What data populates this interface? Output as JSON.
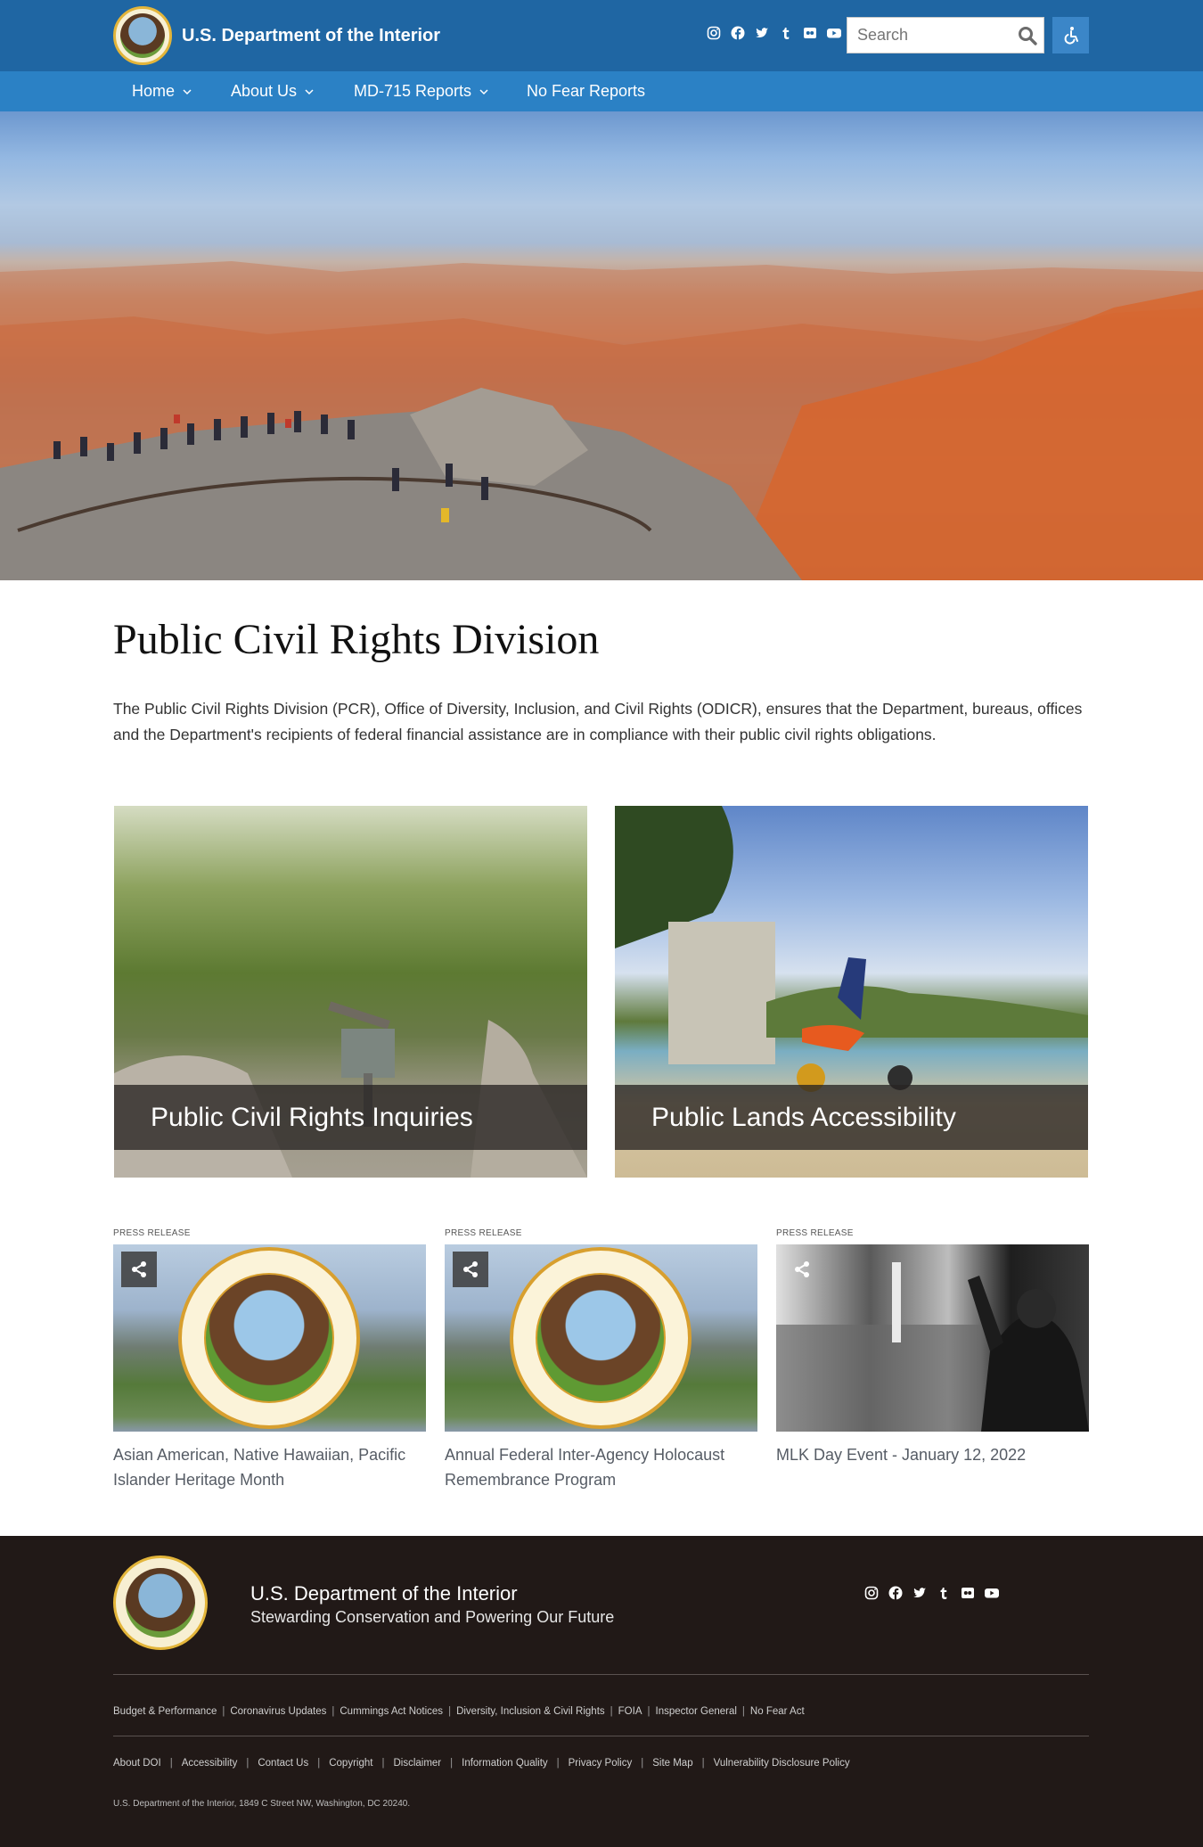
{
  "header": {
    "brand_name": "U.S. Department of the Interior",
    "social": [
      "instagram-icon",
      "facebook-icon",
      "twitter-icon",
      "tumblr-icon",
      "flickr-icon",
      "youtube-icon"
    ],
    "search_placeholder": "Search",
    "colors": {
      "topbar": "#1f66a3",
      "navbar": "#2b81c5"
    }
  },
  "nav": {
    "items": [
      {
        "label": "Home",
        "has_dropdown": true
      },
      {
        "label": "About Us",
        "has_dropdown": true
      },
      {
        "label": "MD-715 Reports",
        "has_dropdown": true
      },
      {
        "label": "No Fear Reports",
        "has_dropdown": false
      }
    ]
  },
  "main": {
    "title": "Public Civil Rights Division",
    "intro": "The Public Civil Rights Division (PCR), Office of Diversity, Inclusion, and Civil Rights (ODICR), ensures that the Department, bureaus, offices and the Department's recipients of federal financial assistance are in compliance with their public civil rights obligations."
  },
  "cards": [
    {
      "label": "Public Civil Rights Inquiries"
    },
    {
      "label": "Public Lands Accessibility"
    }
  ],
  "press": [
    {
      "tag": "PRESS RELEASE",
      "title": "Asian American, Native Hawaiian, Pacific Islander Heritage Month"
    },
    {
      "tag": "PRESS RELEASE",
      "title": "Annual Federal Inter-Agency Holocaust Remembrance Program"
    },
    {
      "tag": "PRESS RELEASE",
      "title": "MLK Day Event - January 12, 2022"
    }
  ],
  "footer": {
    "name": "U.S. Department of the Interior",
    "tagline": "Stewarding Conservation and Powering Our Future",
    "links_row1": [
      "Budget & Performance",
      "Coronavirus Updates",
      "Cummings Act Notices",
      "Diversity, Inclusion & Civil Rights",
      "FOIA",
      "Inspector General",
      "No Fear Act"
    ],
    "links_row2": [
      "About DOI",
      "Accessibility",
      "Contact Us",
      "Copyright",
      "Disclaimer",
      "Information Quality",
      "Privacy Policy",
      "Site Map",
      "Vulnerability Disclosure Policy"
    ],
    "address": "U.S. Department of the Interior, 1849 C Street NW, Washington, DC 20240.",
    "background": "#211917"
  }
}
